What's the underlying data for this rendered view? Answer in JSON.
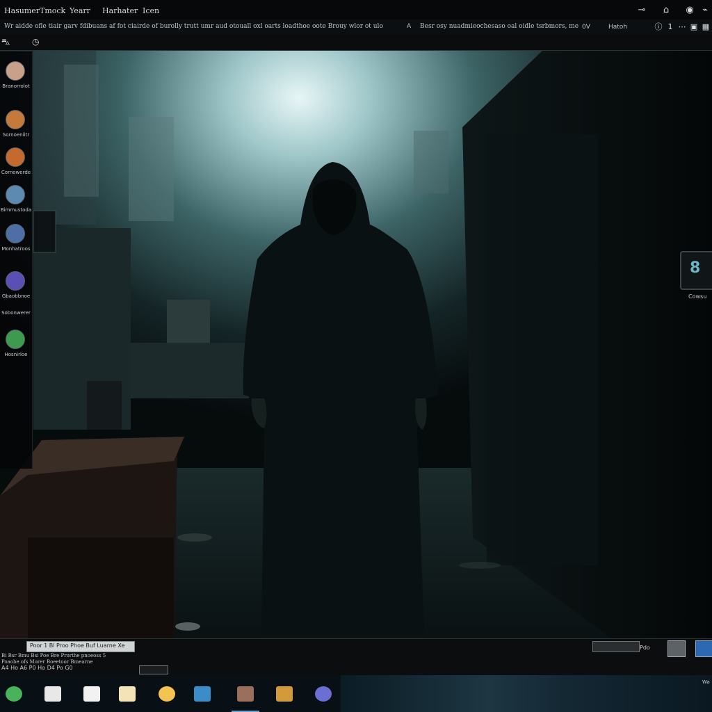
{
  "menubar": {
    "items": [
      "Hasumer",
      "Tmock",
      "Yearr",
      "Harhater",
      "Icen"
    ],
    "icons": [
      "key-icon",
      "home-icon",
      "camera-icon",
      "pin-icon"
    ]
  },
  "addressbar": {
    "url": "Wr aidde ofle tiair garv fdibuans af fot ciairde of burolly trutt umr aud otouall oxl oarts loadthoe oote Brouy wlor ot ulo",
    "separator": "A",
    "url2": "Besr osy nuadmieochesaso oal oidle tsrbmors, me canol",
    "button_left": "0V",
    "button_right": "Hatoh",
    "page_number": "1",
    "icons": [
      "info-icon",
      "page-indicator",
      "ellipsis-icon",
      "screen-icon",
      "grid-icon"
    ]
  },
  "toolbar2": {
    "icons": [
      "car-icon",
      "clock-icon"
    ]
  },
  "dock": {
    "items": [
      {
        "label": "Branorrolot",
        "icon": "portrait-icon",
        "color": "#c9a089"
      },
      {
        "label": "Sornoeniitr",
        "icon": "planet-icon",
        "color": "#c57a3c"
      },
      {
        "label": "Cornowerde",
        "icon": "globe-icon",
        "color": "#c46a2e"
      },
      {
        "label": "Bimmustoda",
        "icon": "earth-icon",
        "color": "#5c8ab0"
      },
      {
        "label": "Monhatroos",
        "icon": "bird-icon",
        "color": "#4d6fa6"
      },
      {
        "label": "Gbaobbnoe",
        "icon": "galaxy-icon",
        "color": "#5a4fb5"
      },
      {
        "label": "Sobonwerer",
        "icon": "dashes-icon",
        "color": "#222a2e"
      },
      {
        "label": "Hosnirloe",
        "icon": "leaf-icon",
        "color": "#3e9a4f"
      }
    ]
  },
  "desktop_icon": {
    "glyph": "8",
    "label": "Cowsu"
  },
  "status": {
    "box_text": "Poor 1 Bl Proo Phoe Buf Luarne Xe",
    "line1": "Bi Bsr Bmu Bsi Poe Bre Prorthe pnoeoss 5",
    "line2": "Poaohe ofs Morer Boeetoor Bmearne",
    "controls": "A4 Ho A6 P0 Ho D4 Po G0",
    "right_label": "Pdo"
  },
  "taskbar": {
    "apps": [
      {
        "name": "app-green",
        "color": "#48b35a"
      },
      {
        "name": "app-white",
        "color": "#e8e8e8"
      },
      {
        "name": "app-file",
        "color": "#f2f2f2"
      },
      {
        "name": "app-note",
        "color": "#f4e3b4"
      },
      {
        "name": "app-folder",
        "color": "#f3c44f"
      },
      {
        "name": "app-photo",
        "color": "#3a8dc8"
      },
      {
        "name": "app-gallery",
        "color": "#9a6f5c"
      },
      {
        "name": "app-media",
        "color": "#d29a38"
      },
      {
        "name": "app-globe",
        "color": "#6b6fd4"
      }
    ],
    "tray": "Wa"
  }
}
